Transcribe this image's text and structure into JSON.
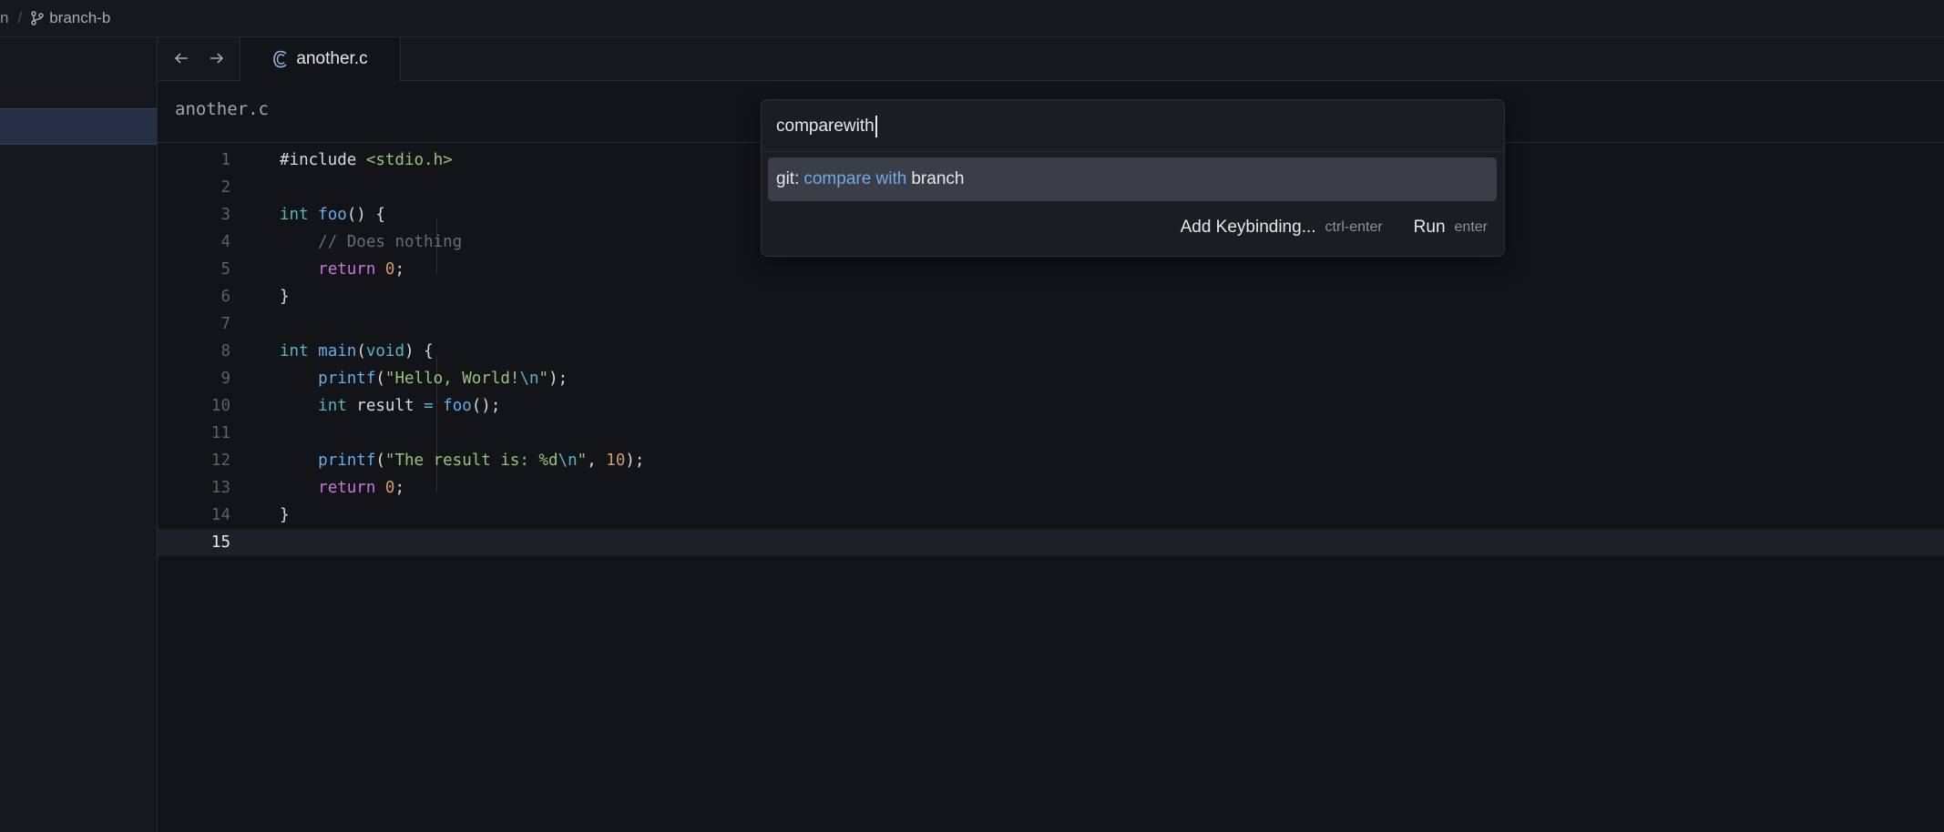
{
  "titlebar": {
    "project": "n",
    "separator": "/",
    "branch": "branch-b"
  },
  "tab": {
    "filename": "another.c",
    "icon": "c-language-icon"
  },
  "breadcrumb": {
    "file": "another.c"
  },
  "editor": {
    "line_numbers": [
      "1",
      "2",
      "3",
      "4",
      "5",
      "6",
      "7",
      "8",
      "9",
      "10",
      "11",
      "12",
      "13",
      "14",
      "15"
    ],
    "active_line": 15
  },
  "palette": {
    "query": "comparewith",
    "results": [
      {
        "prefix": "git:",
        "highlight": "compare with",
        "suffix": "branch"
      }
    ],
    "footer": {
      "add_keybinding_label": "Add Keybinding...",
      "add_keybinding_key": "ctrl-enter",
      "run_label": "Run",
      "run_key": "enter"
    }
  },
  "colors": {
    "background": "#131418",
    "selection": "#3a3e47",
    "match_highlight": "#74a8e6"
  }
}
